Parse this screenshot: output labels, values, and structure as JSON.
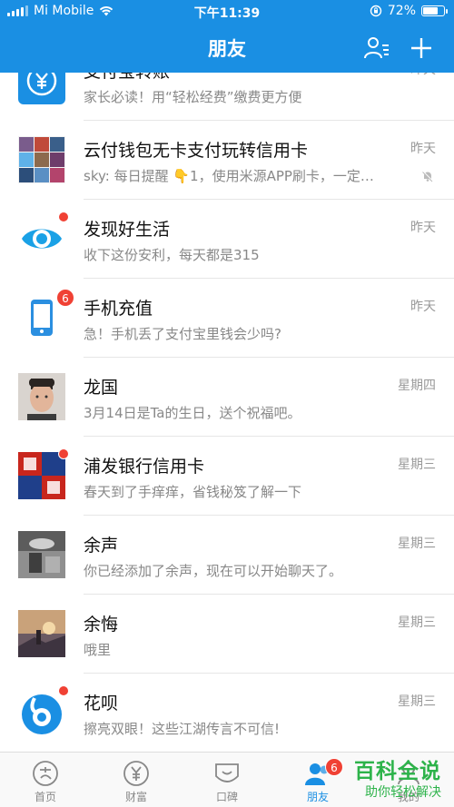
{
  "status_bar": {
    "carrier": "Mi Mobile",
    "time": "下午11:39",
    "battery": "72%",
    "battery_level": 0.72
  },
  "header": {
    "title": "朋友",
    "contacts_icon": "contacts-icon",
    "add_icon": "plus-icon"
  },
  "conversations": [
    {
      "name": "支付宝转账",
      "message": "家长必读！用“轻松经费”缴费更方便",
      "time": "昨天"
    },
    {
      "name": "云付钱包无卡支付玩转信用卡",
      "message": "sky: 每日提醒 👇1，使用米源APP刷卡，一定…",
      "time": "昨天",
      "muted": true
    },
    {
      "name": "发现好生活",
      "message": "收下这份安利，每天都是315",
      "time": "昨天",
      "dot": true
    },
    {
      "name": "手机充值",
      "message": "急！手机丢了支付宝里钱会少吗?",
      "time": "昨天",
      "badge": "6"
    },
    {
      "name": "龙国",
      "message": "3月14日是Ta的生日，送个祝福吧。",
      "time": "星期四"
    },
    {
      "name": "浦发银行信用卡",
      "message": "春天到了手痒痒，省钱秘笈了解一下",
      "time": "星期三",
      "dot": true
    },
    {
      "name": "余声",
      "message": "你已经添加了余声，现在可以开始聊天了。",
      "time": "星期三"
    },
    {
      "name": "余悔",
      "message": "哦里",
      "time": "星期三"
    },
    {
      "name": "花呗",
      "message": "擦亮双眼！这些江湖传言不可信!",
      "time": "星期三",
      "dot": true
    }
  ],
  "tabs": [
    {
      "label": "首页",
      "icon": "alipay-home-icon"
    },
    {
      "label": "财富",
      "icon": "yen-icon"
    },
    {
      "label": "口碑",
      "icon": "koubei-icon"
    },
    {
      "label": "朋友",
      "icon": "friends-icon",
      "active": true,
      "badge": "6"
    },
    {
      "label": "我的",
      "icon": "me-icon"
    }
  ],
  "watermark": {
    "title": "百科全说",
    "subtitle": "助你轻松解决"
  },
  "colors": {
    "brand": "#1a8fe3",
    "alert": "#f04134",
    "watermark": "#2db34a"
  }
}
